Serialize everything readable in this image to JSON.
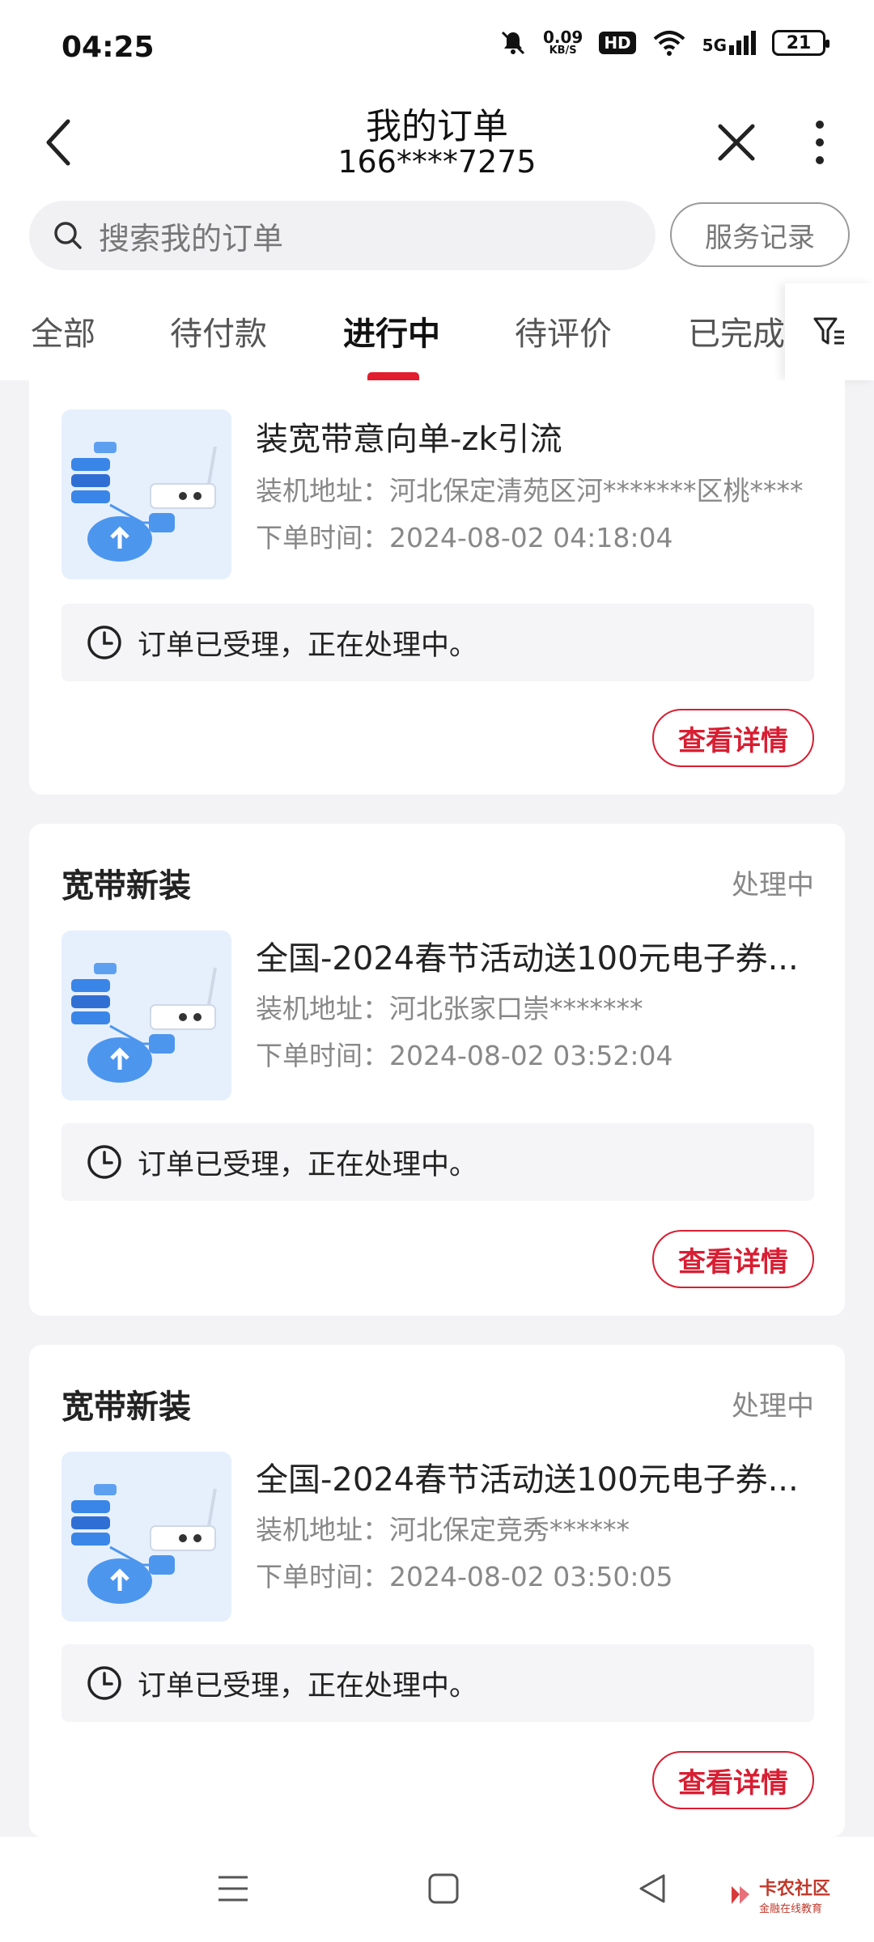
{
  "status_bar": {
    "time": "04:25",
    "net_speed": "0.09",
    "net_unit": "KB/S",
    "hd": "HD",
    "signal": "5G",
    "battery": "21"
  },
  "header": {
    "title": "我的订单",
    "subtitle": "166****7275"
  },
  "search": {
    "placeholder": "搜索我的订单",
    "service_button": "服务记录"
  },
  "tabs": [
    {
      "label": "全部"
    },
    {
      "label": "待付款"
    },
    {
      "label": "进行中"
    },
    {
      "label": "待评价"
    },
    {
      "label": "已完成"
    }
  ],
  "active_tab": "进行中",
  "orders": [
    {
      "category": "",
      "state": "",
      "title": "装宽带意向单-zk引流",
      "address": "装机地址：河北保定清苑区河*******区桃****",
      "time": "下单时间：2024-08-02 04:18:04",
      "notice": "订单已受理，正在处理中。",
      "action": "查看详情"
    },
    {
      "category": "宽带新装",
      "state": "处理中",
      "title": "全国-2024春节活动送100元电子券...",
      "address": "装机地址：河北张家口崇*******",
      "time": "下单时间：2024-08-02 03:52:04",
      "notice": "订单已受理，正在处理中。",
      "action": "查看详情"
    },
    {
      "category": "宽带新装",
      "state": "处理中",
      "title": "全国-2024春节活动送100元电子券...",
      "address": "装机地址：河北保定竞秀******",
      "time": "下单时间：2024-08-02 03:50:05",
      "notice": "订单已受理，正在处理中。",
      "action": "查看详情"
    }
  ],
  "watermark": {
    "main": "卡农社区",
    "sub": "金融在线教育"
  },
  "colors": {
    "accent": "#e11d2e",
    "background": "#f3f3f5"
  }
}
